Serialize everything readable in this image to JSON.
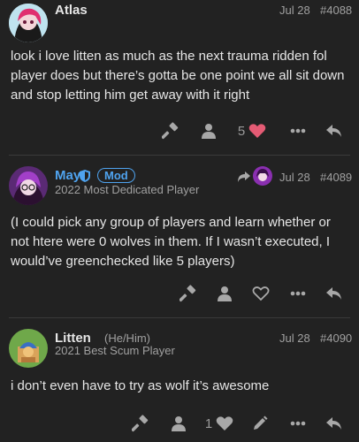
{
  "posts": [
    {
      "username": "Atlas",
      "date": "Jul 28",
      "number": "#4088",
      "body": "look i love litten as much as the next trauma ridden fol player does but there’s gotta be one point we all sit down and stop letting him get away with it right",
      "like_count": "5"
    },
    {
      "username": "May",
      "badge": "Mod",
      "title": "2022 Most Dedicated Player",
      "date": "Jul 28",
      "number": "#4089",
      "body": "(I could pick any group of players and learn whether or not htere were 0 wolves in them. If I wasn’t executed, I would’ve greenchecked like 5 players)"
    },
    {
      "username": "Litten",
      "pronouns": "(He/Him)",
      "title": "2021 Best Scum Player",
      "date": "Jul 28",
      "number": "#4090",
      "body": "i don’t even have to try as wolf it’s awesome",
      "like_count": "1"
    }
  ],
  "colors": {
    "background": "#222222",
    "heart_liked": "#e45b74",
    "mod_blue": "#4fa3ef"
  }
}
